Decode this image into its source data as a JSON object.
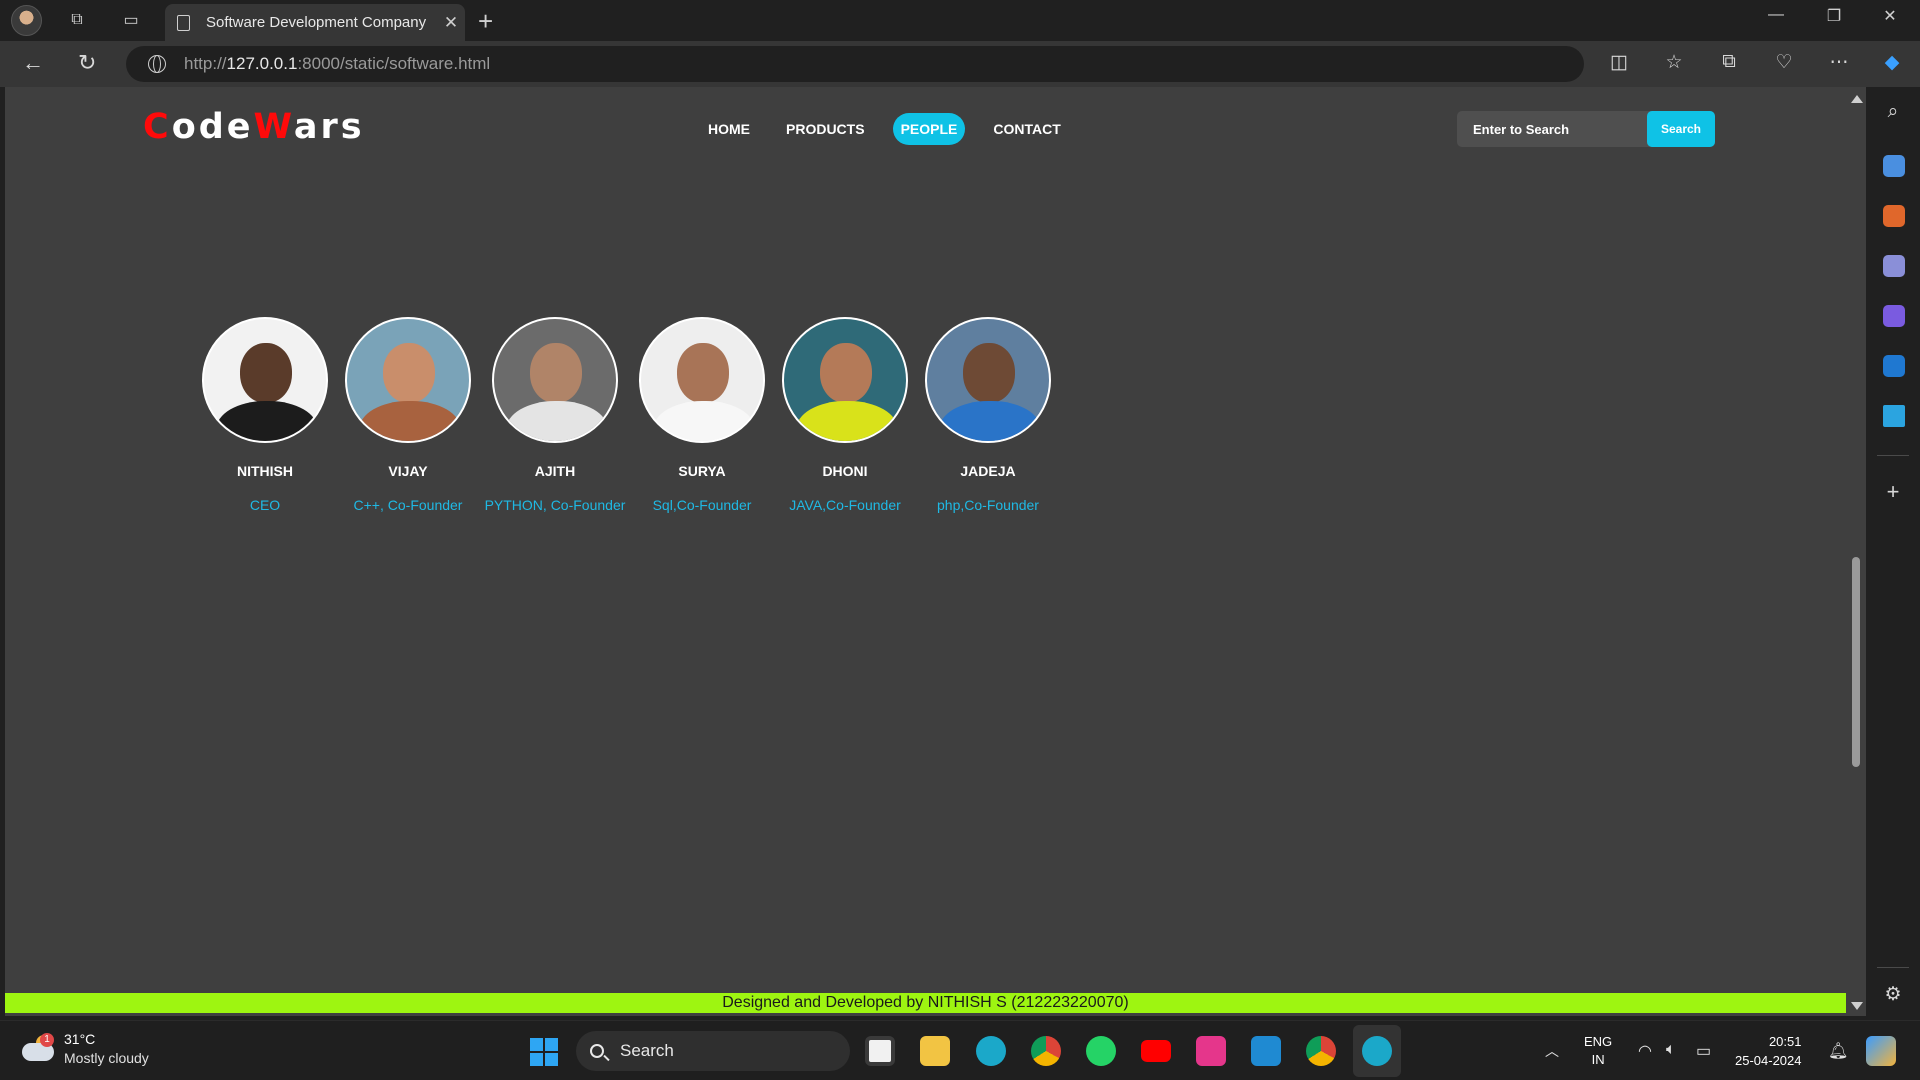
{
  "browser": {
    "tab_title": "Software Development Company",
    "url_scheme": "http://",
    "url_host": "127.0.0.1",
    "url_path": ":8000/static/software.html"
  },
  "site": {
    "logo": {
      "part1_red": "C",
      "part1_rest": "ode",
      "part2_red": "W",
      "part2_rest": "ars"
    },
    "nav": [
      {
        "label": "HOME",
        "active": false
      },
      {
        "label": "PRODUCTS",
        "active": false
      },
      {
        "label": "PEOPLE",
        "active": true
      },
      {
        "label": "CONTACT",
        "active": false
      }
    ],
    "search": {
      "placeholder": "Enter to Search",
      "button_label": "Search"
    },
    "people": [
      {
        "name": "NITHISH",
        "role": "CEO"
      },
      {
        "name": "VIJAY",
        "role": "C++, Co-Founder"
      },
      {
        "name": "AJITH",
        "role": "PYTHON, Co-Founder"
      },
      {
        "name": "SURYA",
        "role": "Sql,Co-Founder"
      },
      {
        "name": "DHONI",
        "role": "JAVA,Co-Founder"
      },
      {
        "name": "JADEJA",
        "role": "php,Co-Founder"
      }
    ],
    "footer": "Designed and Developed by NITHISH S (212223220070)"
  },
  "taskbar": {
    "weather_temp": "31°C",
    "weather_condition": "Mostly cloudy",
    "weather_badge": "1",
    "search_label": "Search",
    "lang_line1": "ENG",
    "lang_line2": "IN",
    "time": "20:51",
    "date": "25-04-2024"
  },
  "colors": {
    "accent_cyan": "#0fc2e6",
    "logo_red": "#ff0a0a",
    "footer_green": "#9ef511",
    "page_bg": "#3f3f3f"
  }
}
